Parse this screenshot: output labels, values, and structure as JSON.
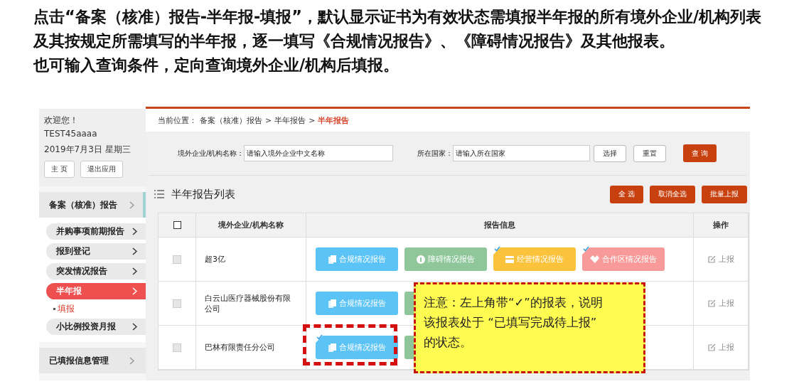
{
  "intro": [
    "点击“备案（核准）报告-半年报-填报”，默认显示证书为有效状态需填报半年报的所有境外企业/机构列表及其按规定所需填写的半年报，逐一填写《合规情况报告》、《障碍情况报告》及其他报表。",
    "也可输入查询条件，定向查询境外企业/机构后填报。"
  ],
  "user": {
    "greeting": "欢迎您！",
    "name": "TEST45aaaa",
    "date": "2019年7月3日 星期三",
    "buttons": [
      "主 页",
      "退出应用"
    ]
  },
  "sidebar": [
    {
      "label": "备案（核准）报告",
      "kind": "section",
      "selected": true
    },
    {
      "label": "并购事项前期报告",
      "kind": "item",
      "selected": false
    },
    {
      "label": "报到登记",
      "kind": "item",
      "selected": false
    },
    {
      "label": "突发情况报告",
      "kind": "item",
      "selected": false
    },
    {
      "label": "半年报",
      "kind": "item",
      "selected": true,
      "children": [
        {
          "label": "填报",
          "selected": true
        }
      ]
    },
    {
      "label": "小比例投资月报",
      "kind": "item",
      "selected": false
    },
    {
      "label": "已填报信息管理",
      "kind": "section",
      "selected": false
    }
  ],
  "breadcrumb": {
    "prefix": "当前位置：",
    "parts": [
      "备案（核准）报告",
      ">",
      "半年报告",
      ">",
      "半年报告"
    ]
  },
  "search": {
    "name_label": "境外企业/机构名称：",
    "name_placeholder": "请输入境外企业中文名称",
    "country_label": "所在国家：",
    "country_placeholder": "请输入所在国家",
    "choose": "选择",
    "reset": "重置",
    "query": "查 询"
  },
  "list": {
    "title": "半年报告列表",
    "actions": [
      "全 选",
      "取消全选",
      "批量上报"
    ]
  },
  "table": {
    "header_checked": false,
    "columns": [
      "境外企业/机构名称",
      "报告信息",
      "操作"
    ],
    "rows": [
      {
        "checked": false,
        "name": "超3亿",
        "action": "上报",
        "reports": [
          {
            "kind": "compliance",
            "label": "合规情况报告",
            "done": false,
            "color": "#5bc3f5"
          },
          {
            "kind": "obstacle",
            "label": "障碍情况报告",
            "done": false,
            "color": "#8fc79b"
          },
          {
            "kind": "operation",
            "label": "经营情况报告",
            "done": true,
            "color": "#fbc23c"
          },
          {
            "kind": "zone",
            "label": "合作区情况报告",
            "done": true,
            "color": "#f89a9a"
          }
        ]
      },
      {
        "checked": false,
        "name": "白云山医疗器械股份有限公司",
        "action": "上报",
        "reports": [
          {
            "kind": "compliance",
            "label": "合规情况报告",
            "done": false,
            "color": "#5bc3f5"
          },
          {
            "color": "#8fc79b"
          }
        ]
      },
      {
        "checked": false,
        "name": "巴林有限责任分公司",
        "action": "上报",
        "highlighted": true,
        "reports": [
          {
            "kind": "compliance",
            "label": "合规情况报告",
            "done": true,
            "color": "#5bc3f5"
          },
          {
            "color": "#8fc79b"
          }
        ]
      }
    ]
  },
  "callout": {
    "lines": [
      "注意：左上角带“✓”的报表，说明",
      "该报表处于 “已填写完成待上报”",
      "的状态。"
    ]
  }
}
